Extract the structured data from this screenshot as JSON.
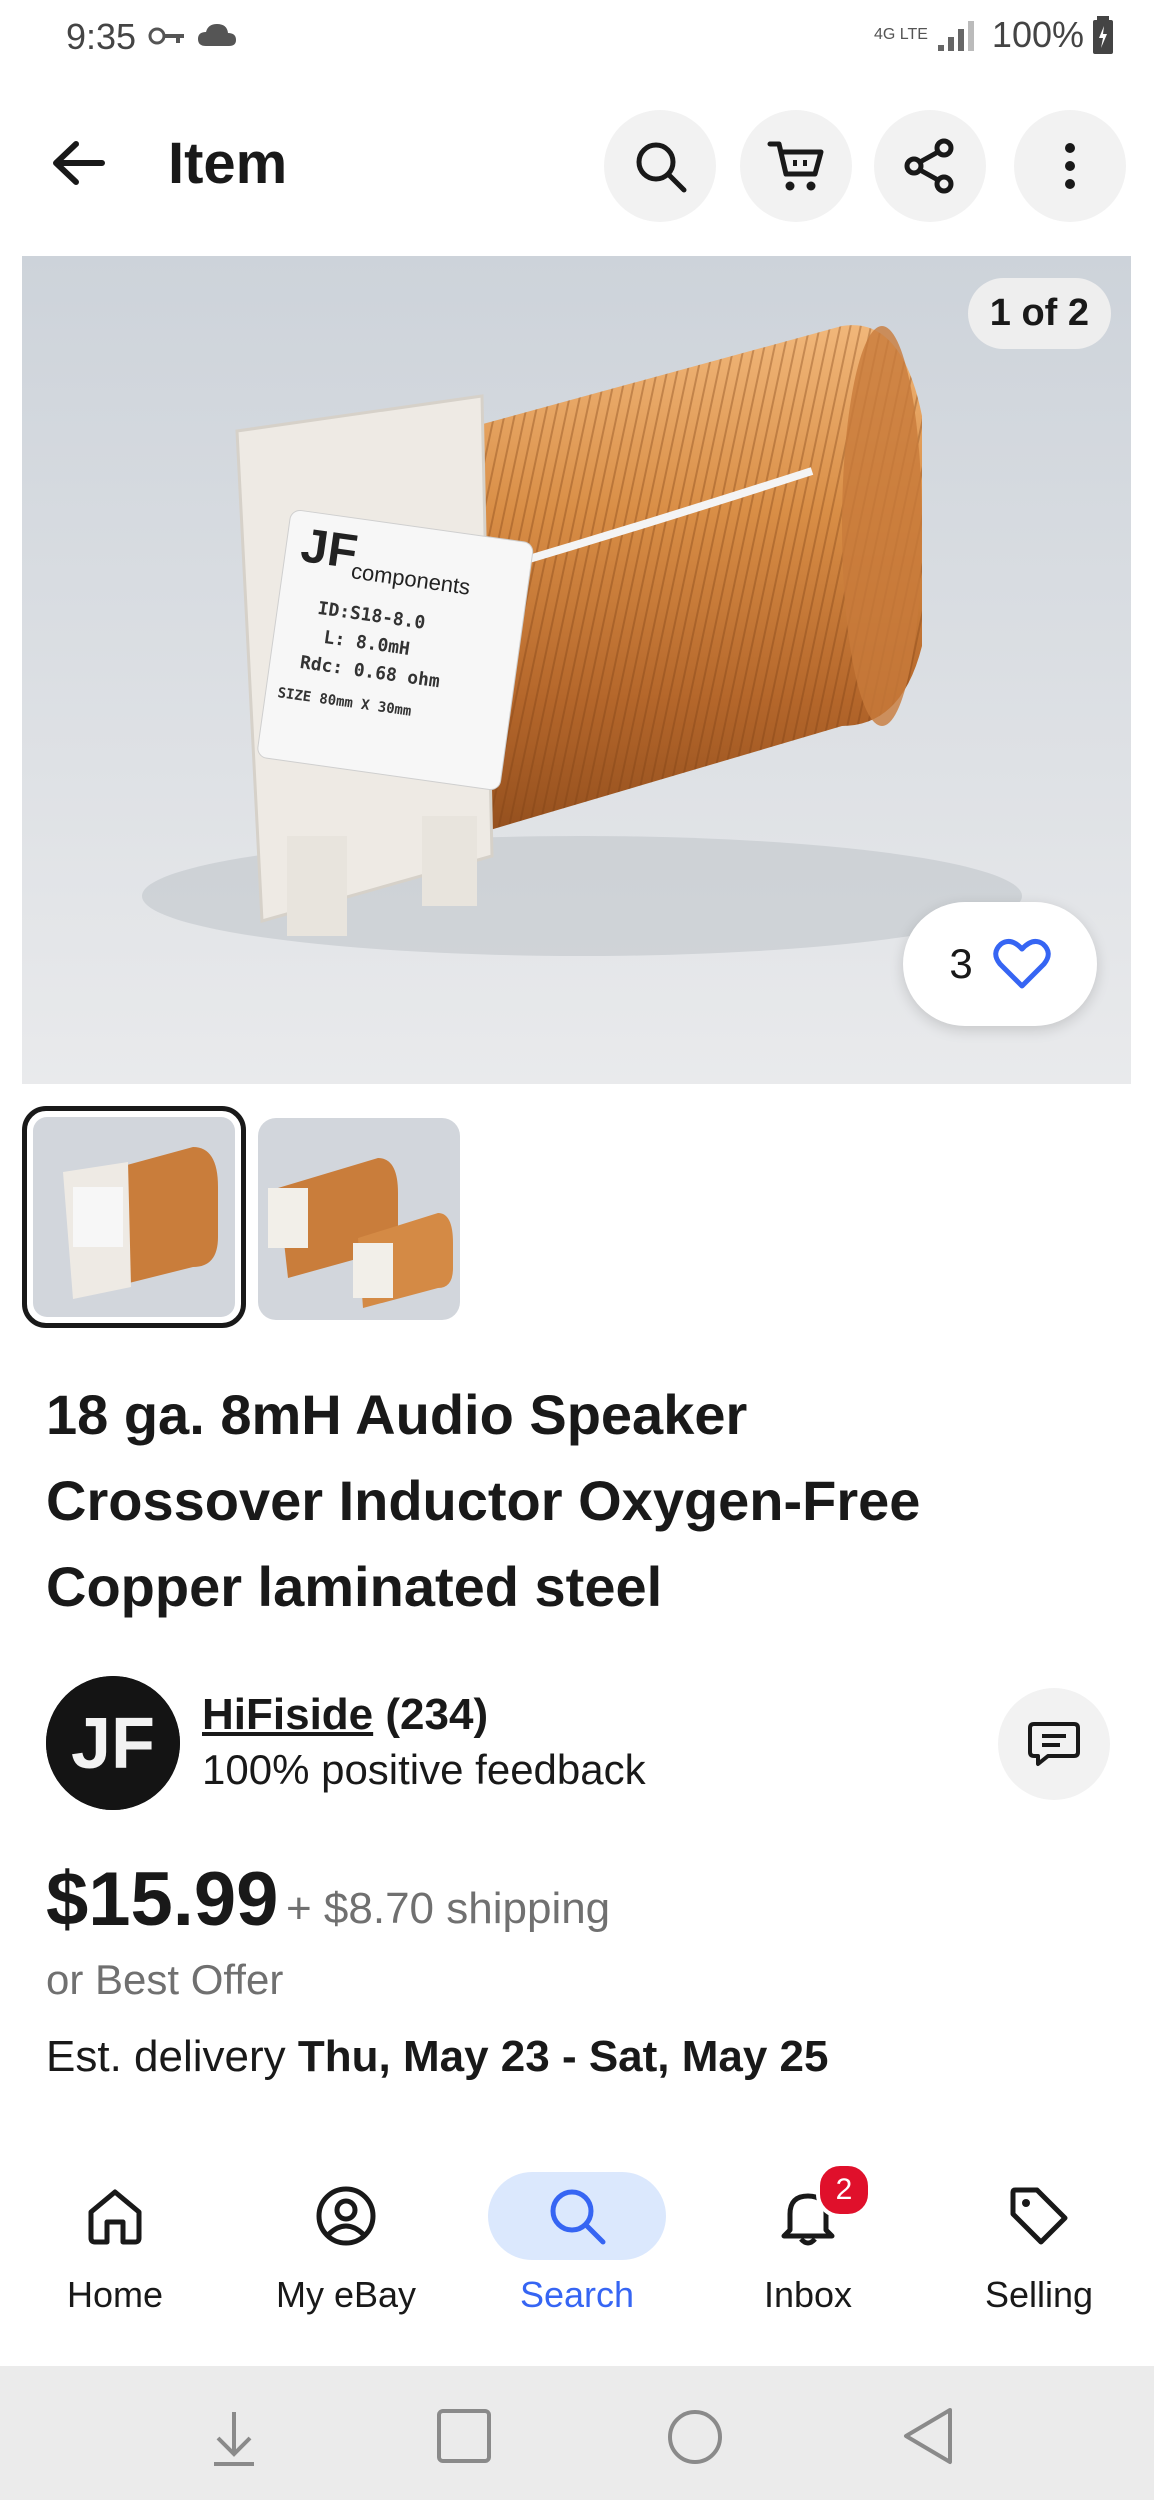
{
  "status_bar": {
    "time": "9:35",
    "battery": "100%",
    "network": "4G LTE"
  },
  "header": {
    "title": "Item",
    "icons": [
      "back-arrow-icon",
      "search-icon",
      "cart-icon",
      "share-icon",
      "more-vertical-icon"
    ]
  },
  "gallery": {
    "counter": "1 of 2",
    "favorites_count": "3",
    "label_brand": "JF",
    "label_brand_sub": "components",
    "label_lines": [
      "ID:S18-8.0",
      "L: 8.0mH",
      "Rdc: 0.68 ohm",
      "SIZE 80mm X 30mm"
    ],
    "thumbnails": 2
  },
  "product": {
    "title": "18 ga. 8mH Audio Speaker Crossover Inductor Oxygen-Free Copper laminated steel",
    "title_lines": [
      "18 ga. 8mH Audio Speaker",
      "Crossover Inductor Oxygen-Free",
      "Copper laminated steel"
    ]
  },
  "seller": {
    "avatar_text": "JF",
    "name": "HiFiside",
    "count": "(234)",
    "feedback": "100% positive feedback"
  },
  "pricing": {
    "price": "$15.99",
    "shipping": "+ $8.70 shipping",
    "offer": "or Best Offer",
    "delivery_label": "Est. delivery",
    "delivery_dates": "Thu, May 23 - Sat, May 25"
  },
  "bottom_nav": {
    "items": [
      {
        "label": "Home",
        "icon": "home-icon"
      },
      {
        "label": "My eBay",
        "icon": "user-circle-icon"
      },
      {
        "label": "Search",
        "icon": "search-icon",
        "active": true
      },
      {
        "label": "Inbox",
        "icon": "bell-icon",
        "badge": "2"
      },
      {
        "label": "Selling",
        "icon": "tag-icon"
      }
    ]
  },
  "colors": {
    "accent": "#3665f3",
    "badge": "#e0102b",
    "text": "#191919",
    "secondary_text": "#707070"
  }
}
